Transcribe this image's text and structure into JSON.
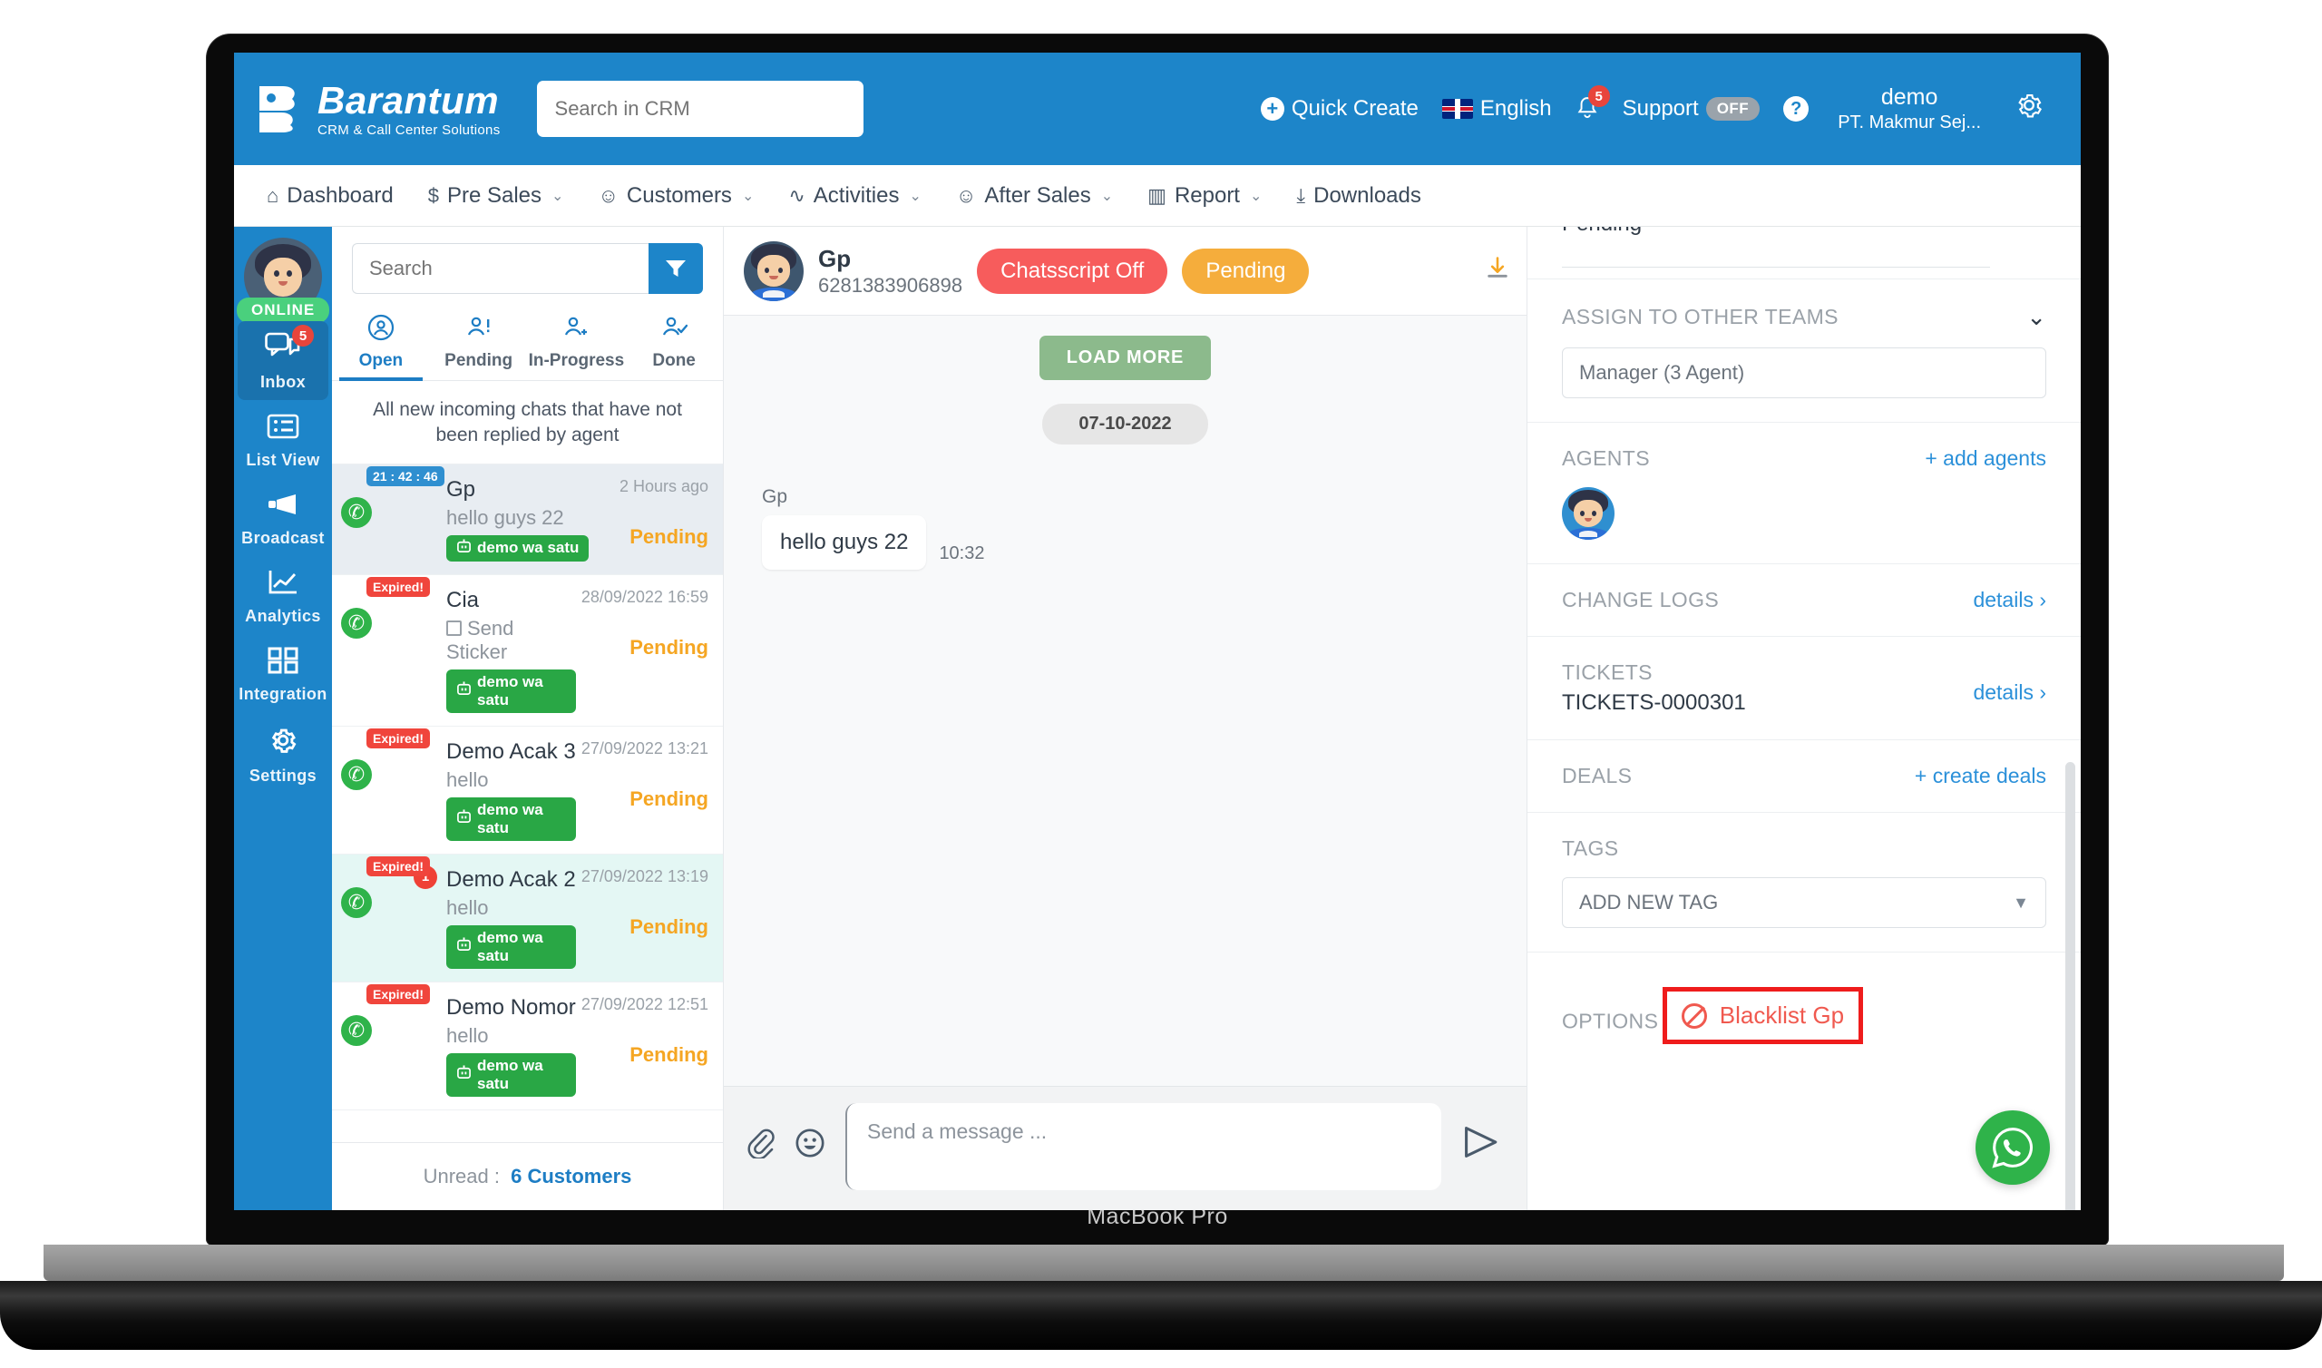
{
  "device": {
    "label": "MacBook Pro"
  },
  "header": {
    "brand_name": "Barantum",
    "brand_tagline": "CRM & Call Center Solutions",
    "search_placeholder": "Search in CRM",
    "search_value": "",
    "quick_create": "Quick Create",
    "language": "English",
    "notification_count": "5",
    "support_label": "Support",
    "support_state": "OFF",
    "help_icon": "question-mark-icon",
    "user_name": "demo",
    "user_company": "PT. Makmur Sej...",
    "gear_icon": "gear-icon"
  },
  "nav": {
    "items": [
      {
        "label": "Dashboard",
        "icon": "home-icon",
        "caret": false
      },
      {
        "label": "Pre Sales",
        "icon": "dollar-icon",
        "caret": true
      },
      {
        "label": "Customers",
        "icon": "person-icon",
        "caret": true
      },
      {
        "label": "Activities",
        "icon": "pulse-icon",
        "caret": true
      },
      {
        "label": "After Sales",
        "icon": "person-icon",
        "caret": true
      },
      {
        "label": "Report",
        "icon": "bar-chart-icon",
        "caret": true
      },
      {
        "label": "Downloads",
        "icon": "download-icon",
        "caret": false
      }
    ]
  },
  "rail": {
    "status": "ONLINE",
    "items": [
      {
        "label": "Inbox",
        "icon": "chat-bubbles-icon",
        "badge": "5",
        "active": true
      },
      {
        "label": "List View",
        "icon": "list-icon",
        "badge": "",
        "active": false
      },
      {
        "label": "Broadcast",
        "icon": "megaphone-icon",
        "badge": "",
        "active": false
      },
      {
        "label": "Analytics",
        "icon": "line-chart-icon",
        "badge": "",
        "active": false
      },
      {
        "label": "Integration",
        "icon": "grid-squares-icon",
        "badge": "",
        "active": false
      },
      {
        "label": "Settings",
        "icon": "gear-icon",
        "badge": "",
        "active": false
      }
    ]
  },
  "chatlist": {
    "search_placeholder": "Search",
    "search_value": "",
    "filter_icon": "funnel-icon",
    "tabs": [
      {
        "label": "Open",
        "icon": "user-circle-icon",
        "active": true
      },
      {
        "label": "Pending",
        "icon": "user-alert-icon",
        "active": false
      },
      {
        "label": "In-Progress",
        "icon": "user-add-icon",
        "active": false
      },
      {
        "label": "Done",
        "icon": "user-check-icon",
        "active": false
      }
    ],
    "note": "All new incoming chats that have not been replied by agent",
    "items": [
      {
        "name": "Gp",
        "message": "hello guys 22",
        "sticker": false,
        "channel": "demo wa satu",
        "date": "2 Hours ago",
        "status": "Pending",
        "timer": "21 : 42 : 46",
        "expired": false,
        "unread": "",
        "highlight": "grey"
      },
      {
        "name": "Cia",
        "message": "Send Sticker",
        "sticker": true,
        "channel": "demo wa satu",
        "date": "28/09/2022 16:59",
        "status": "Pending",
        "timer": "Expired!",
        "expired": true,
        "unread": "",
        "highlight": ""
      },
      {
        "name": "Demo Acak 3",
        "message": "hello",
        "sticker": false,
        "channel": "demo wa satu",
        "date": "27/09/2022 13:21",
        "status": "Pending",
        "timer": "Expired!",
        "expired": true,
        "unread": "",
        "highlight": ""
      },
      {
        "name": "Demo Acak 2",
        "message": "hello",
        "sticker": false,
        "channel": "demo wa satu",
        "date": "27/09/2022 13:19",
        "status": "Pending",
        "timer": "Expired!",
        "expired": true,
        "unread": "1",
        "highlight": "mint"
      },
      {
        "name": "Demo Nomor",
        "message": "hello",
        "sticker": false,
        "channel": "demo wa satu",
        "date": "27/09/2022 12:51",
        "status": "Pending",
        "timer": "Expired!",
        "expired": true,
        "unread": "",
        "highlight": ""
      }
    ],
    "footer_label": "Unread :",
    "footer_value": "6 Customers"
  },
  "conversation": {
    "contact_name": "Gp",
    "contact_phone": "6281383906898",
    "chatscript_pill": "Chatsscript Off",
    "status_pill": "Pending",
    "download_icon": "download-icon",
    "load_more": "LOAD MORE",
    "date_separator": "07-10-2022",
    "messages": [
      {
        "sender": "Gp",
        "text": "hello guys 22",
        "time": "10:32"
      }
    ],
    "composer": {
      "attach_icon": "paperclip-icon",
      "emoji_icon": "smiley-icon",
      "placeholder": "Send a message ...",
      "value": "",
      "send_icon": "send-icon"
    }
  },
  "detail": {
    "partial_top_text": "Pending",
    "assign_label": "ASSIGN TO OTHER TEAMS",
    "assign_caret": "chevron-down-icon",
    "assign_value": "Manager (3 Agent)",
    "agents_label": "AGENTS",
    "add_agents_link": "+ add agents",
    "changelogs_label": "CHANGE LOGS",
    "changelogs_link": "details",
    "tickets_label": "TICKETS",
    "tickets_value": "TICKETS-0000301",
    "tickets_link": "details",
    "deals_label": "DEALS",
    "deals_link": "+ create deals",
    "tags_label": "TAGS",
    "tags_value": "ADD NEW TAG",
    "options_label": "OPTIONS",
    "blacklist_label": "Blacklist Gp",
    "blacklist_icon": "ban-icon",
    "whatsapp_fab_icon": "whatsapp-icon"
  },
  "colors": {
    "brand_blue": "#1d85c9",
    "accent_link": "#2b90d9",
    "status_pending": "#f5a623",
    "danger_red": "#ef1c1c",
    "whatsapp_green": "#2fb34a",
    "highlight_box": "#ef1c1c"
  }
}
